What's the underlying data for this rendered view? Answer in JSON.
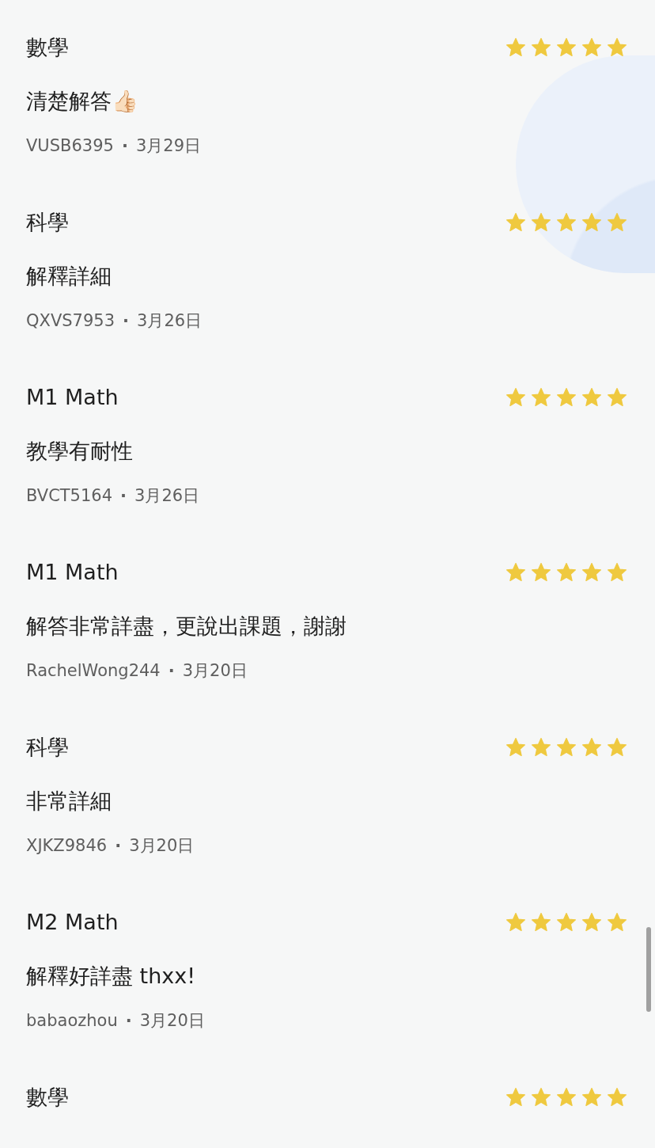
{
  "reviews": [
    {
      "subject": "數學",
      "stars": 5,
      "comment": "清楚解答👍🏻",
      "user": "VUSB6395",
      "separator": "·",
      "date": "3月29日"
    },
    {
      "subject": "科學",
      "stars": 5,
      "comment": "解釋詳細",
      "user": "QXVS7953",
      "separator": "·",
      "date": "3月26日"
    },
    {
      "subject": "M1 Math",
      "stars": 5,
      "comment": "教學有耐性",
      "user": "BVCT5164",
      "separator": "·",
      "date": "3月26日"
    },
    {
      "subject": "M1 Math",
      "stars": 5,
      "comment": "解答非常詳盡，更說出課題，謝謝",
      "user": "RachelWong244",
      "separator": "·",
      "date": "3月20日"
    },
    {
      "subject": "科學",
      "stars": 5,
      "comment": "非常詳細",
      "user": "XJKZ9846",
      "separator": "·",
      "date": "3月20日"
    },
    {
      "subject": "M2 Math",
      "stars": 5,
      "comment": "解釋好詳盡 thxx!",
      "user": "babaozhou",
      "separator": "·",
      "date": "3月20日"
    },
    {
      "subject": "數學",
      "stars": 5
    }
  ]
}
